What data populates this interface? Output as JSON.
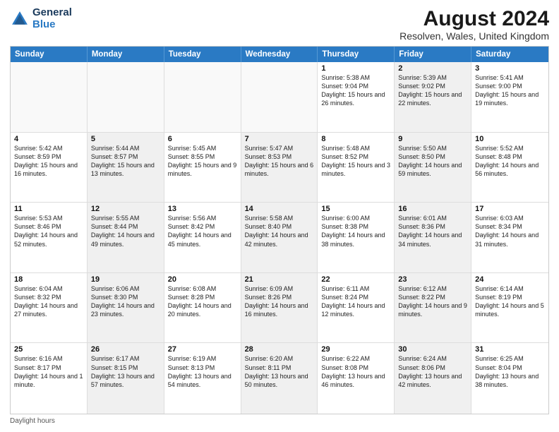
{
  "header": {
    "logo_line1": "General",
    "logo_line2": "Blue",
    "main_title": "August 2024",
    "subtitle": "Resolven, Wales, United Kingdom"
  },
  "calendar": {
    "days_of_week": [
      "Sunday",
      "Monday",
      "Tuesday",
      "Wednesday",
      "Thursday",
      "Friday",
      "Saturday"
    ],
    "weeks": [
      [
        {
          "day": "",
          "info": "",
          "shaded": false,
          "empty": true
        },
        {
          "day": "",
          "info": "",
          "shaded": false,
          "empty": true
        },
        {
          "day": "",
          "info": "",
          "shaded": false,
          "empty": true
        },
        {
          "day": "",
          "info": "",
          "shaded": false,
          "empty": true
        },
        {
          "day": "1",
          "info": "Sunrise: 5:38 AM\nSunset: 9:04 PM\nDaylight: 15 hours\nand 26 minutes.",
          "shaded": false,
          "empty": false
        },
        {
          "day": "2",
          "info": "Sunrise: 5:39 AM\nSunset: 9:02 PM\nDaylight: 15 hours\nand 22 minutes.",
          "shaded": true,
          "empty": false
        },
        {
          "day": "3",
          "info": "Sunrise: 5:41 AM\nSunset: 9:00 PM\nDaylight: 15 hours\nand 19 minutes.",
          "shaded": false,
          "empty": false
        }
      ],
      [
        {
          "day": "4",
          "info": "Sunrise: 5:42 AM\nSunset: 8:59 PM\nDaylight: 15 hours\nand 16 minutes.",
          "shaded": false,
          "empty": false
        },
        {
          "day": "5",
          "info": "Sunrise: 5:44 AM\nSunset: 8:57 PM\nDaylight: 15 hours\nand 13 minutes.",
          "shaded": true,
          "empty": false
        },
        {
          "day": "6",
          "info": "Sunrise: 5:45 AM\nSunset: 8:55 PM\nDaylight: 15 hours\nand 9 minutes.",
          "shaded": false,
          "empty": false
        },
        {
          "day": "7",
          "info": "Sunrise: 5:47 AM\nSunset: 8:53 PM\nDaylight: 15 hours\nand 6 minutes.",
          "shaded": true,
          "empty": false
        },
        {
          "day": "8",
          "info": "Sunrise: 5:48 AM\nSunset: 8:52 PM\nDaylight: 15 hours\nand 3 minutes.",
          "shaded": false,
          "empty": false
        },
        {
          "day": "9",
          "info": "Sunrise: 5:50 AM\nSunset: 8:50 PM\nDaylight: 14 hours\nand 59 minutes.",
          "shaded": true,
          "empty": false
        },
        {
          "day": "10",
          "info": "Sunrise: 5:52 AM\nSunset: 8:48 PM\nDaylight: 14 hours\nand 56 minutes.",
          "shaded": false,
          "empty": false
        }
      ],
      [
        {
          "day": "11",
          "info": "Sunrise: 5:53 AM\nSunset: 8:46 PM\nDaylight: 14 hours\nand 52 minutes.",
          "shaded": false,
          "empty": false
        },
        {
          "day": "12",
          "info": "Sunrise: 5:55 AM\nSunset: 8:44 PM\nDaylight: 14 hours\nand 49 minutes.",
          "shaded": true,
          "empty": false
        },
        {
          "day": "13",
          "info": "Sunrise: 5:56 AM\nSunset: 8:42 PM\nDaylight: 14 hours\nand 45 minutes.",
          "shaded": false,
          "empty": false
        },
        {
          "day": "14",
          "info": "Sunrise: 5:58 AM\nSunset: 8:40 PM\nDaylight: 14 hours\nand 42 minutes.",
          "shaded": true,
          "empty": false
        },
        {
          "day": "15",
          "info": "Sunrise: 6:00 AM\nSunset: 8:38 PM\nDaylight: 14 hours\nand 38 minutes.",
          "shaded": false,
          "empty": false
        },
        {
          "day": "16",
          "info": "Sunrise: 6:01 AM\nSunset: 8:36 PM\nDaylight: 14 hours\nand 34 minutes.",
          "shaded": true,
          "empty": false
        },
        {
          "day": "17",
          "info": "Sunrise: 6:03 AM\nSunset: 8:34 PM\nDaylight: 14 hours\nand 31 minutes.",
          "shaded": false,
          "empty": false
        }
      ],
      [
        {
          "day": "18",
          "info": "Sunrise: 6:04 AM\nSunset: 8:32 PM\nDaylight: 14 hours\nand 27 minutes.",
          "shaded": false,
          "empty": false
        },
        {
          "day": "19",
          "info": "Sunrise: 6:06 AM\nSunset: 8:30 PM\nDaylight: 14 hours\nand 23 minutes.",
          "shaded": true,
          "empty": false
        },
        {
          "day": "20",
          "info": "Sunrise: 6:08 AM\nSunset: 8:28 PM\nDaylight: 14 hours\nand 20 minutes.",
          "shaded": false,
          "empty": false
        },
        {
          "day": "21",
          "info": "Sunrise: 6:09 AM\nSunset: 8:26 PM\nDaylight: 14 hours\nand 16 minutes.",
          "shaded": true,
          "empty": false
        },
        {
          "day": "22",
          "info": "Sunrise: 6:11 AM\nSunset: 8:24 PM\nDaylight: 14 hours\nand 12 minutes.",
          "shaded": false,
          "empty": false
        },
        {
          "day": "23",
          "info": "Sunrise: 6:12 AM\nSunset: 8:22 PM\nDaylight: 14 hours\nand 9 minutes.",
          "shaded": true,
          "empty": false
        },
        {
          "day": "24",
          "info": "Sunrise: 6:14 AM\nSunset: 8:19 PM\nDaylight: 14 hours\nand 5 minutes.",
          "shaded": false,
          "empty": false
        }
      ],
      [
        {
          "day": "25",
          "info": "Sunrise: 6:16 AM\nSunset: 8:17 PM\nDaylight: 14 hours\nand 1 minute.",
          "shaded": false,
          "empty": false
        },
        {
          "day": "26",
          "info": "Sunrise: 6:17 AM\nSunset: 8:15 PM\nDaylight: 13 hours\nand 57 minutes.",
          "shaded": true,
          "empty": false
        },
        {
          "day": "27",
          "info": "Sunrise: 6:19 AM\nSunset: 8:13 PM\nDaylight: 13 hours\nand 54 minutes.",
          "shaded": false,
          "empty": false
        },
        {
          "day": "28",
          "info": "Sunrise: 6:20 AM\nSunset: 8:11 PM\nDaylight: 13 hours\nand 50 minutes.",
          "shaded": true,
          "empty": false
        },
        {
          "day": "29",
          "info": "Sunrise: 6:22 AM\nSunset: 8:08 PM\nDaylight: 13 hours\nand 46 minutes.",
          "shaded": false,
          "empty": false
        },
        {
          "day": "30",
          "info": "Sunrise: 6:24 AM\nSunset: 8:06 PM\nDaylight: 13 hours\nand 42 minutes.",
          "shaded": true,
          "empty": false
        },
        {
          "day": "31",
          "info": "Sunrise: 6:25 AM\nSunset: 8:04 PM\nDaylight: 13 hours\nand 38 minutes.",
          "shaded": false,
          "empty": false
        }
      ]
    ]
  },
  "footer": {
    "note": "Daylight hours"
  }
}
